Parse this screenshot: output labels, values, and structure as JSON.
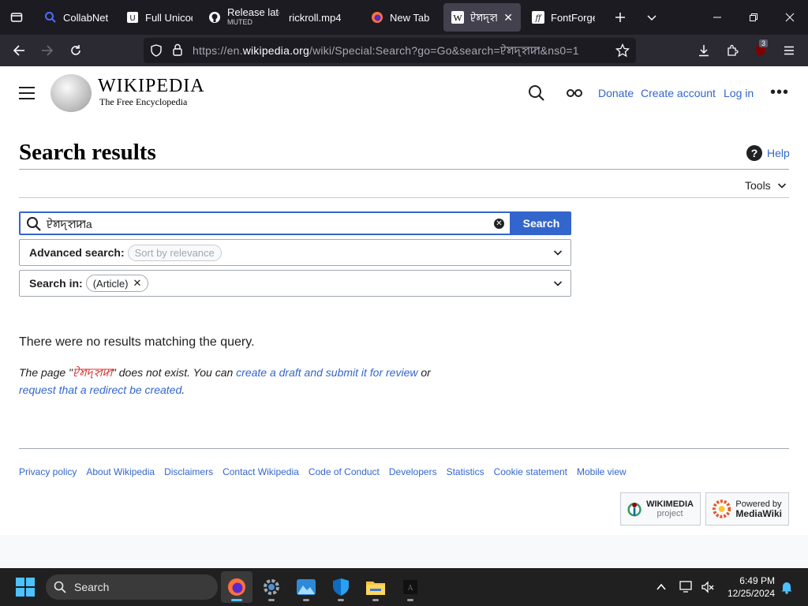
{
  "browser": {
    "tabs": [
      {
        "title": "CollabNet",
        "icon": "search-icon"
      },
      {
        "title": "Full Unicode",
        "icon": "unicode-icon"
      },
      {
        "title": "Release late",
        "subtitle": "MUTED",
        "icon": "github-icon"
      },
      {
        "title": "rickroll.mp4",
        "icon": "video-icon"
      },
      {
        "title": "New Tab",
        "icon": "firefox-icon"
      },
      {
        "title": "ꠄꠝꠖꠡꠇ",
        "icon": "wikipedia-icon",
        "active": true
      },
      {
        "title": "FontForge",
        "icon": "fontforge-icon"
      }
    ],
    "url_prefix": "https://en.",
    "url_domain": "wikipedia.org",
    "url_path": "/wiki/Special:Search?go=Go&search=ꠄꠝꠖꠡꠇ&ns0=1",
    "extension_badge": "3"
  },
  "wiki": {
    "wordmark": "WIKIPEDIA",
    "tagline": "The Free Encyclopedia",
    "header_links": {
      "donate": "Donate",
      "create_account": "Create account",
      "login": "Log in"
    },
    "page_title": "Search results",
    "help": "Help",
    "tools": "Tools",
    "search": {
      "value": "ꠄꠝꠖꠡꠇa",
      "button": "Search"
    },
    "advanced": {
      "label": "Advanced search:",
      "sort": "Sort by relevance"
    },
    "search_in": {
      "label": "Search in:",
      "namespace": "(Article)"
    },
    "no_results": "There were no results matching the query.",
    "para": {
      "prefix": "The page \"",
      "missing_title": "ꠄꠝꠖꠡꠇ",
      "middle": "\" does not exist. You can ",
      "link1": "create a draft and submit it for review",
      "or": " or",
      "link2": "request that a redirect be created",
      "end": "."
    },
    "footer_links": [
      "Privacy policy",
      "About Wikipedia",
      "Disclaimers",
      "Contact Wikipedia",
      "Code of Conduct",
      "Developers",
      "Statistics",
      "Cookie statement",
      "Mobile view"
    ],
    "wikimedia_badge": {
      "line1": "WIKIMEDIA",
      "line2": "project"
    },
    "mediawiki_badge": {
      "line1": "Powered by",
      "line2": "MediaWiki"
    }
  },
  "taskbar": {
    "search": "Search",
    "time": "6:49 PM",
    "date": "12/25/2024"
  }
}
